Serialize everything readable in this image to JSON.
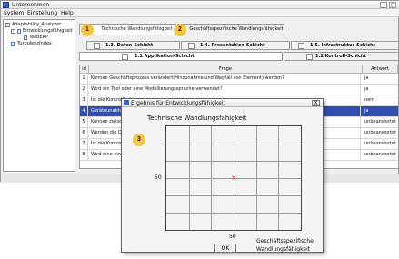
{
  "window": {
    "title": "Unternehmen",
    "buttons": {
      "minimize": "_",
      "maximize": "□"
    }
  },
  "menu": [
    "System",
    "Einstellung",
    "Help"
  ],
  "tree": {
    "root": "Adaptability_Analyzer",
    "child": "Entwicklungsfähigkeit",
    "leaf": "webERP",
    "sibling": "TurbulenzIndex"
  },
  "tabs": [
    "Technische Wandlungsfähigkeit",
    "Geschäftsspezifische Wandlungsfähigkeit"
  ],
  "subtabs": {
    "row1": [
      "1.3. Daten-Schicht",
      "1.4. Presentation-Schicht",
      "1.5. Infrastruktur-Schicht"
    ],
    "row2": [
      "1.1 Applikation-Schicht",
      "1.2 Kontroll-Schicht"
    ]
  },
  "table": {
    "headers": [
      "id",
      "Frage",
      "Antwort"
    ],
    "rows": [
      {
        "id": "1",
        "q": "Können Geschäftsprozess verändert(Hinzunahme und Wegfall von Element) werden?",
        "a": "ja"
      },
      {
        "id": "2",
        "q": "Wird ein Tool oder eine Modellierungssprache verwendet?",
        "a": "ja"
      },
      {
        "id": "3",
        "q": "Ist die Kontrolllschi",
        "a": "nein"
      },
      {
        "id": "4",
        "q": "Geräteunabhängig",
        "a": "ja"
      },
      {
        "id": "5",
        "q": "Können zwischen",
        "a": "unbeanwortet"
      },
      {
        "id": "6",
        "q": "Werden die Dater",
        "a": "unbeanwortet"
      },
      {
        "id": "7",
        "q": "Ist die Kontrollsch",
        "a": "unbeanwortet"
      },
      {
        "id": "8",
        "q": "Wird eine einheitli",
        "a": "unbeanwortet"
      }
    ],
    "selected_row": 4
  },
  "callouts": [
    "1",
    "2",
    "3"
  ],
  "dialog": {
    "title": "Ergebnis für Entwicklungsfähigkeit",
    "close": "X",
    "ok_label": "OK"
  },
  "chart_data": {
    "type": "scatter",
    "ylabel": "Technische Wandlungsfähigkeit",
    "xlabel": "Geschäftsspezifische Wandlungsfähigkeit",
    "x_tick": "50",
    "y_tick": "50",
    "xlim": [
      0,
      100
    ],
    "ylim": [
      0,
      100
    ],
    "grid": true,
    "points": [
      {
        "x": 50,
        "y": 50,
        "marker": "x"
      }
    ],
    "colors": {
      "point": "#d23a3a"
    }
  },
  "colors": {
    "selection": "#2f4fb0",
    "callout": "#f5c542"
  }
}
